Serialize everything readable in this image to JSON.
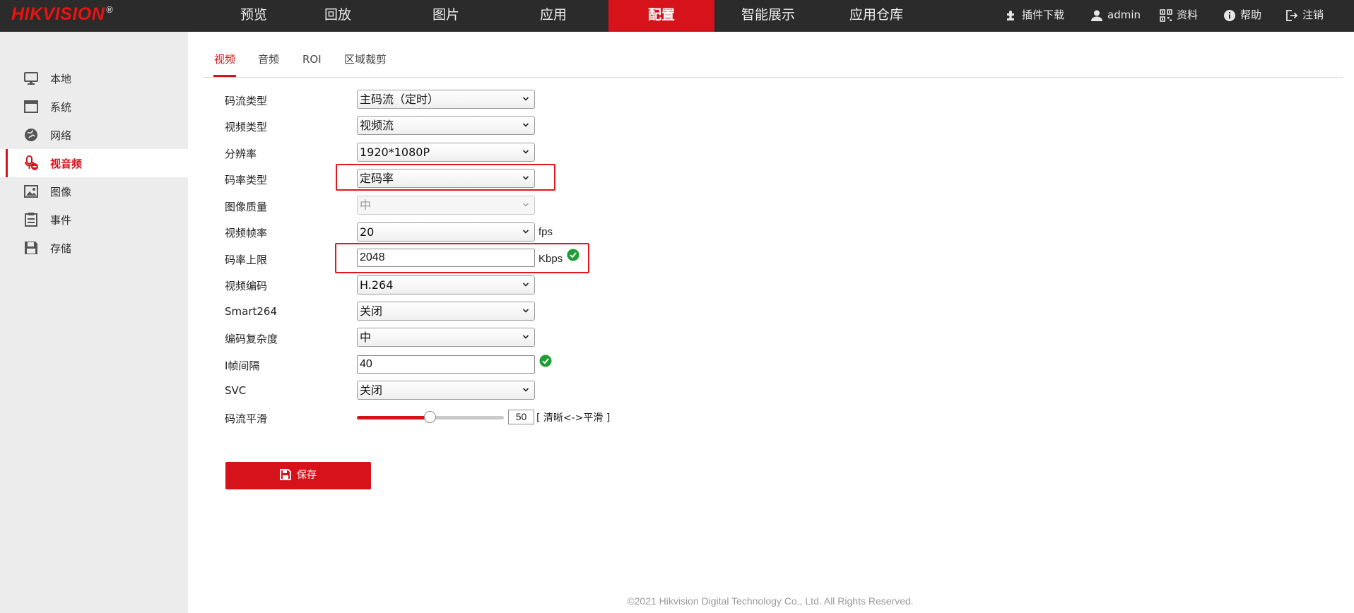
{
  "brand": {
    "logo_text": "HIKVISION",
    "registered": "®"
  },
  "nav": {
    "items": [
      "预览",
      "回放",
      "图片",
      "应用",
      "配置",
      "智能展示",
      "应用仓库"
    ],
    "active": "配置"
  },
  "utilities": {
    "plugin_download": "插件下载",
    "user": "admin",
    "docs": "资料",
    "help": "帮助",
    "logout": "注销"
  },
  "sidebar": {
    "items": [
      {
        "label": "本地",
        "icon": "monitor-icon"
      },
      {
        "label": "系统",
        "icon": "system-window-icon"
      },
      {
        "label": "网络",
        "icon": "globe-icon"
      },
      {
        "label": "视音频",
        "icon": "microphone-icon"
      },
      {
        "label": "图像",
        "icon": "image-icon"
      },
      {
        "label": "事件",
        "icon": "event-list-icon"
      },
      {
        "label": "存储",
        "icon": "floppy-disk-icon"
      }
    ],
    "active": "视音频"
  },
  "tabs": {
    "items": [
      "视频",
      "音频",
      "ROI",
      "区域裁剪"
    ],
    "active": "视频"
  },
  "form": {
    "stream_type": {
      "label": "码流类型",
      "value": "主码流（定时）"
    },
    "video_type": {
      "label": "视频类型",
      "value": "视频流"
    },
    "resolution": {
      "label": "分辨率",
      "value": "1920*1080P"
    },
    "bitrate_type": {
      "label": "码率类型",
      "value": "定码率"
    },
    "image_quality": {
      "label": "图像质量",
      "value": "中"
    },
    "frame_rate": {
      "label": "视频帧率",
      "value": "20",
      "unit": "fps"
    },
    "max_bitrate": {
      "label": "码率上限",
      "value": "2048",
      "unit": "Kbps"
    },
    "video_encoding": {
      "label": "视频编码",
      "value": "H.264"
    },
    "smart264": {
      "label": "Smart264",
      "value": "关闭"
    },
    "encoding_complexity": {
      "label": "编码复杂度",
      "value": "中"
    },
    "i_frame_interval": {
      "label": "I帧间隔",
      "value": "40"
    },
    "svc": {
      "label": "SVC",
      "value": "关闭"
    },
    "stream_smoothing": {
      "label": "码流平滑",
      "value": 50,
      "min": 1,
      "max": 100,
      "display": "50",
      "hint": "[ 清晰<->平滑 ]"
    }
  },
  "save_label": "保存",
  "footer": "©2021 Hikvision Digital Technology Co., Ltd. All Rights Reserved.",
  "colors": {
    "accent": "#d6131b",
    "topbar": "#2b2b2b",
    "sidebar": "#ececec",
    "ok": "#1e9e35"
  }
}
